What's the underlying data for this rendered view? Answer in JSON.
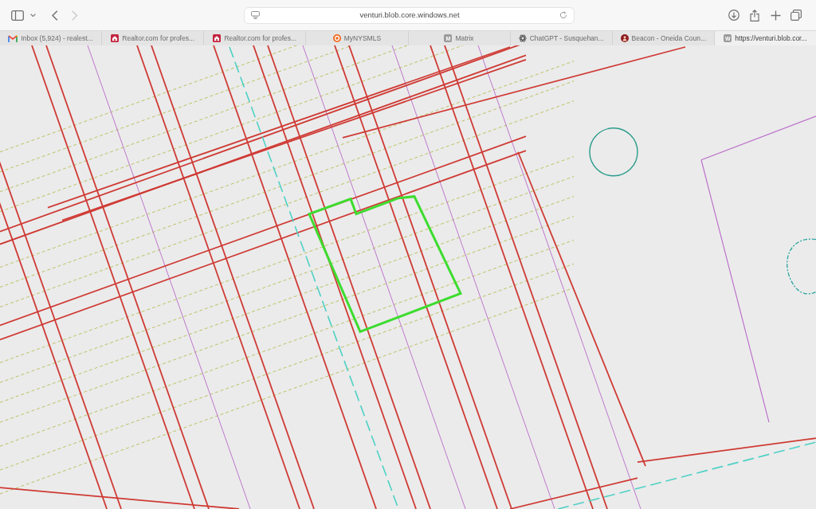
{
  "toolbar": {
    "back": {
      "disabled": false
    },
    "forward": {
      "disabled": true
    },
    "address": {
      "value": "venturi.blob.core.windows.net"
    }
  },
  "tabs": [
    {
      "title": "Inbox (5,924) - realest...",
      "selected": false
    },
    {
      "title": "Realtor.com for profes...",
      "selected": false
    },
    {
      "title": "Realtor.com for profes...",
      "selected": false
    },
    {
      "title": "MyNYSMLS",
      "selected": false
    },
    {
      "title": "Matrix",
      "favicon_letter": "M",
      "selected": false
    },
    {
      "title": "ChatGPT - Susquehan...",
      "selected": false
    },
    {
      "title": "Beacon - Oneida Coun...",
      "selected": false
    },
    {
      "title": "https://venturi.blob.cor...",
      "favicon_letter": "W",
      "selected": true
    }
  ]
}
